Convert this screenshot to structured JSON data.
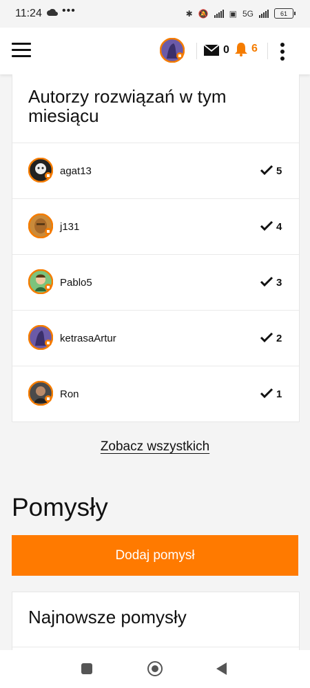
{
  "status_bar": {
    "time": "11:24",
    "network": "5G",
    "battery": "61"
  },
  "header": {
    "messages_count": "0",
    "notifications_count": "6",
    "accent_color": "#ff7a00"
  },
  "solvers_card": {
    "title": "Autorzy rozwiązań w tym miesiącu",
    "rows": [
      {
        "name": "agat13",
        "count": "5"
      },
      {
        "name": "j131",
        "count": "4"
      },
      {
        "name": "Pablo5",
        "count": "3"
      },
      {
        "name": "ketrasaArtur",
        "count": "2"
      },
      {
        "name": "Ron",
        "count": "1"
      }
    ],
    "see_all_label": "Zobacz wszystkich"
  },
  "ideas": {
    "title": "Pomysły",
    "add_button_label": "Dodaj pomysł",
    "latest_title": "Najnowsze pomysły"
  }
}
